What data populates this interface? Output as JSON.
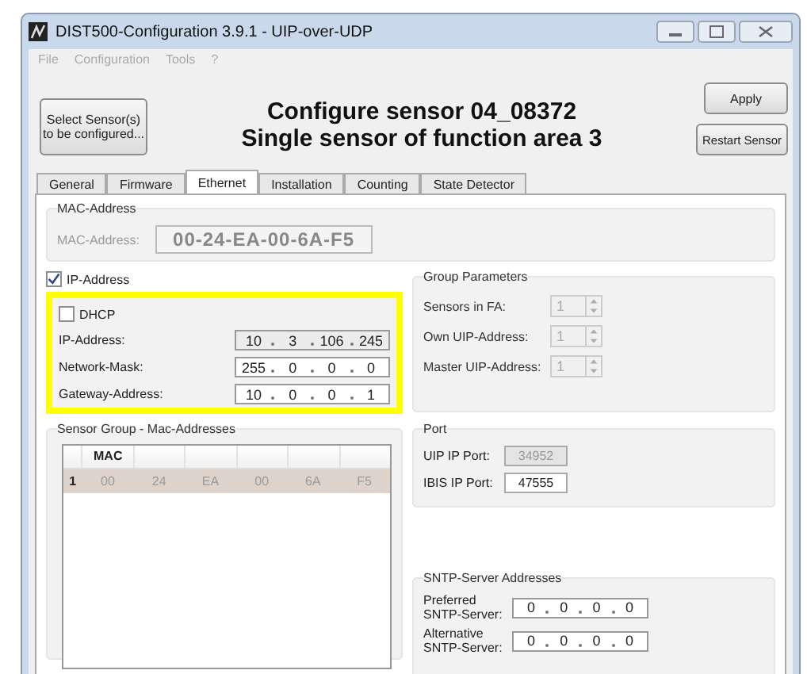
{
  "window": {
    "title": "DIST500-Configuration 3.9.1  -  UIP-over-UDP"
  },
  "menu": [
    {
      "label": "File",
      "disabled": true
    },
    {
      "label": "Configuration",
      "disabled": true
    },
    {
      "label": "Tools",
      "disabled": true
    },
    {
      "label": "?",
      "disabled": true
    }
  ],
  "header": {
    "select_button": "Select Sensor(s) to be configured...",
    "title_lines": [
      "Configure sensor 04_08372",
      "Single sensor of function area 3"
    ],
    "apply_button": "Apply",
    "restart_button": "Restart Sensor"
  },
  "tabs": [
    {
      "label": "General",
      "selected": false
    },
    {
      "label": "Firmware",
      "selected": false
    },
    {
      "label": "Ethernet",
      "selected": true
    },
    {
      "label": "Installation",
      "selected": false
    },
    {
      "label": "Counting",
      "selected": false
    },
    {
      "label": "State Detector",
      "selected": false
    }
  ],
  "mac_group": {
    "title": "MAC-Address",
    "label": "MAC-Address:",
    "value": "00-24-EA-00-6A-F5",
    "disabled": true
  },
  "ip_group": {
    "label": "IP-Address",
    "checked": true,
    "highlighted": true,
    "dhcp": {
      "label": "DHCP",
      "checked": false
    },
    "fields": [
      {
        "label": "IP-Address:",
        "octets": [
          "10",
          "3",
          "106",
          "245"
        ],
        "disabled": true
      },
      {
        "label": "Network-Mask:",
        "octets": [
          "255",
          "0",
          "0",
          "0"
        ],
        "disabled": false
      },
      {
        "label": "Gateway-Address:",
        "octets": [
          "10",
          "0",
          "0",
          "1"
        ],
        "disabled": false
      }
    ]
  },
  "group_parameters": {
    "title": "Group Parameters",
    "rows": [
      {
        "label": "Sensors in FA:",
        "value": "1",
        "disabled": true
      },
      {
        "label": "Own UIP-Address:",
        "value": "1",
        "disabled": true
      },
      {
        "label": "Master UIP-Address:",
        "value": "1",
        "disabled": true
      }
    ]
  },
  "sensor_group": {
    "title": "Sensor Group - Mac-Addresses",
    "table": {
      "columns": [
        "MAC"
      ],
      "rows": [
        {
          "index": "1",
          "cells": [
            "00",
            "24",
            "EA",
            "00",
            "6A",
            "F5"
          ],
          "selected": true
        }
      ]
    }
  },
  "port": {
    "title": "Port",
    "rows": [
      {
        "label": "UIP IP Port:",
        "value": "34952",
        "disabled": true
      },
      {
        "label": "IBIS IP Port:",
        "value": "47555",
        "disabled": false
      }
    ]
  },
  "sntp": {
    "title": "SNTP-Server Addresses",
    "rows": [
      {
        "label": "Preferred SNTP-Server:",
        "octets": [
          "0",
          "0",
          "0",
          "0"
        ]
      },
      {
        "label": "Alternative SNTP-Server:",
        "octets": [
          "0",
          "0",
          "0",
          "0"
        ]
      }
    ]
  }
}
